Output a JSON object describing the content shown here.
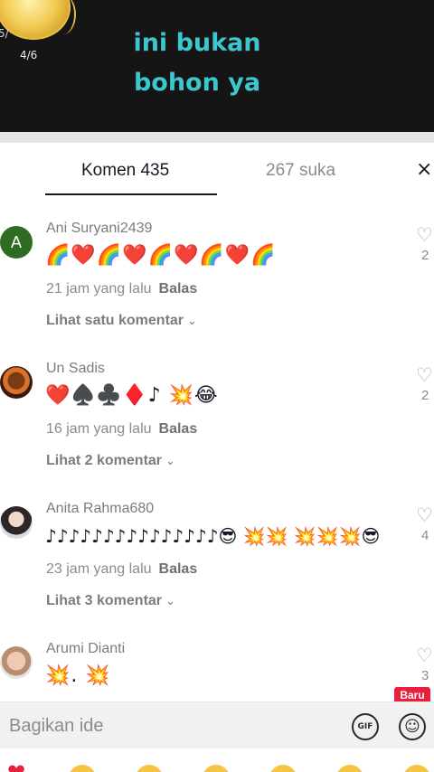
{
  "video": {
    "caption_line1": "ini bukan",
    "caption_line2": "bohon ya",
    "counter": "4/6",
    "coin_left_label": "5/"
  },
  "tabs": {
    "comments": "Komen 435",
    "likes": "267 suka",
    "close_icon": "×"
  },
  "comments": [
    {
      "avatar_letter": "A",
      "username": "Ani Suryani2439",
      "text": "🌈❤️🌈❤️🌈❤️🌈❤️🌈",
      "time": "21 jam yang lalu",
      "reply": "Balas",
      "more": "Lihat satu komentar",
      "likes": "2"
    },
    {
      "avatar_letter": "",
      "username": "Un Sadis",
      "text": "❤️♠️♣️♦️♪ 💥😂",
      "time": "16 jam yang lalu",
      "reply": "Balas",
      "more": "Lihat 2 komentar",
      "likes": "2"
    },
    {
      "avatar_letter": "",
      "username": "Anita Rahma680",
      "text": "♪♪♪♪♪♪♪♪♪♪♪♪♪♪♪😎 💥💥 💥💥💥😎",
      "time": "23 jam yang lalu",
      "reply": "Balas",
      "more": "Lihat 3 komentar",
      "likes": "4"
    },
    {
      "avatar_letter": "",
      "username": "Arumi Dianti",
      "text": "💥. 💥",
      "likes": "3"
    }
  ],
  "input": {
    "placeholder": "Bagikan ide",
    "gif_label": "GIF",
    "new_badge": "Baru"
  },
  "icons": {
    "heart": "♡",
    "chevron": "⌄",
    "emoji": "☺"
  }
}
